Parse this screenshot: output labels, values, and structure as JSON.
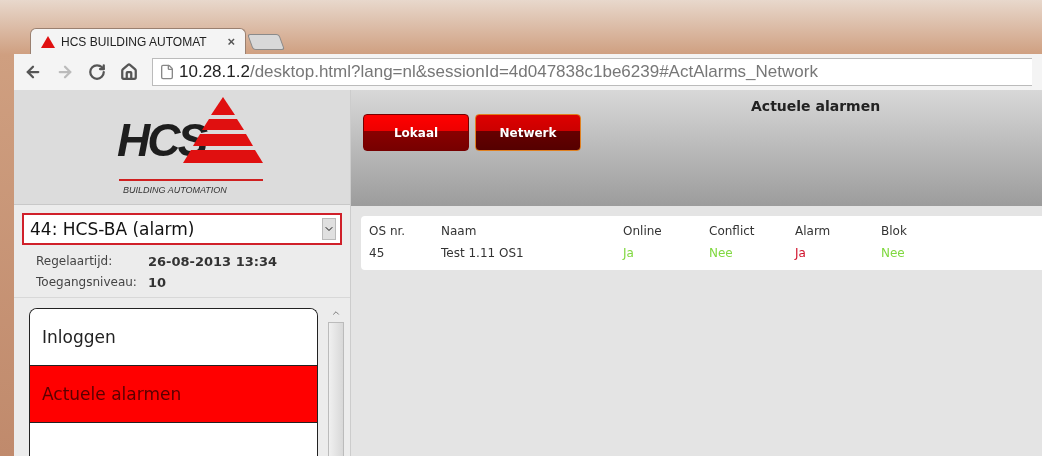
{
  "browser": {
    "tab": {
      "title": "HCS BUILDING AUTOMAT",
      "close": "×"
    },
    "address": {
      "host": "10.28.1.2",
      "path": "/desktop.html?lang=nl&sessionId=4d047838c1be6239#ActAlarms_Network"
    },
    "forward_disabled": true
  },
  "sidebar": {
    "logo": {
      "word": "HCS",
      "tagline": "BUILDING AUTOMATION"
    },
    "station_select": {
      "value": "44: HCS-BA (alarm)"
    },
    "info": [
      {
        "label": "Regelaartijd:",
        "value": "26-08-2013 13:34",
        "bold": true
      },
      {
        "label": "Toegangsniveau:",
        "value": "10",
        "bold": true
      }
    ],
    "menu": [
      {
        "label": "Inloggen",
        "selected": false
      },
      {
        "label": "Actuele alarmen",
        "selected": true
      }
    ]
  },
  "header": {
    "title": "Actuele alarmen",
    "buttons": [
      {
        "label": "Lokaal",
        "selected": false
      },
      {
        "label": "Netwerk",
        "selected": true
      }
    ]
  },
  "table": {
    "columns": [
      "OS nr.",
      "Naam",
      "Online",
      "Conflict",
      "Alarm",
      "Blok"
    ],
    "rows": [
      {
        "cells": [
          {
            "text": "45"
          },
          {
            "text": "Test 1.11 OS1"
          },
          {
            "text": "Ja",
            "color": "#80d840"
          },
          {
            "text": "Nee",
            "color": "#80d840"
          },
          {
            "text": "Ja",
            "color": "#d0102a"
          },
          {
            "text": "Nee",
            "color": "#80d840"
          }
        ]
      }
    ]
  }
}
